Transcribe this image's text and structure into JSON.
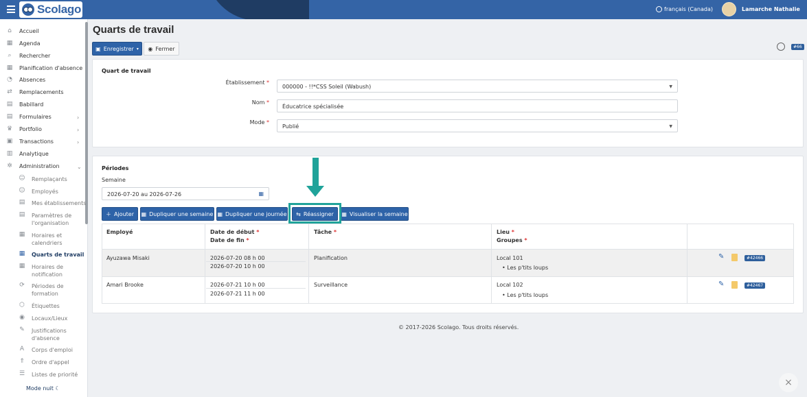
{
  "app": {
    "name": "Scolago"
  },
  "topbar": {
    "language": "français (Canada)",
    "user_name": "Lamarche Nathalie"
  },
  "sidebar": {
    "items": [
      {
        "label": "Accueil",
        "icon": "home-icon"
      },
      {
        "label": "Agenda",
        "icon": "calendar-icon"
      },
      {
        "label": "Rechercher",
        "icon": "search-icon"
      },
      {
        "label": "Planification d'absence",
        "icon": "calendar-icon"
      },
      {
        "label": "Absences",
        "icon": "user-absence-icon"
      },
      {
        "label": "Remplacements",
        "icon": "replacement-icon"
      },
      {
        "label": "Babillard",
        "icon": "board-icon"
      },
      {
        "label": "Formulaires",
        "icon": "form-icon"
      },
      {
        "label": "Portfolio",
        "icon": "trophy-icon"
      },
      {
        "label": "Transactions",
        "icon": "transactions-icon"
      },
      {
        "label": "Analytique",
        "icon": "analytics-icon"
      },
      {
        "label": "Administration",
        "icon": "gear-icon"
      }
    ],
    "admin_items": [
      {
        "label": "Remplaçants"
      },
      {
        "label": "Employés"
      },
      {
        "label": "Mes établissements"
      },
      {
        "label": "Paramètres de",
        "label2": "l'organisation"
      },
      {
        "label": "Horaires et",
        "label2": "calendriers"
      },
      {
        "label": "Quarts de travail"
      },
      {
        "label": "Horaires de",
        "label2": "notification"
      },
      {
        "label": "Périodes de",
        "label2": "formation"
      },
      {
        "label": "Étiquettes"
      },
      {
        "label": "Locaux/Lieux"
      },
      {
        "label": "Justifications",
        "label2": "d'absence"
      },
      {
        "label": "Corps d'emploi"
      },
      {
        "label": "Ordre d'appel"
      },
      {
        "label": "Listes de priorité"
      }
    ],
    "night_mode": "Mode nuit"
  },
  "page": {
    "title": "Quarts de travail",
    "save_label": "Enregistrer",
    "close_label": "Fermer",
    "id_badge": "#66"
  },
  "shift_card": {
    "title": "Quart de travail",
    "establishment_label": "Établissement",
    "establishment_value": "000000 - !!*CSS Soleil (Wabush)",
    "name_label": "Nom",
    "name_value": "Éducatrice spécialisée",
    "mode_label": "Mode",
    "mode_value": "Publié"
  },
  "periods": {
    "title": "Périodes",
    "week_label": "Semaine",
    "week_value": "2026-07-20 au 2026-07-26",
    "buttons": {
      "add": "Ajouter",
      "dup_week": "Dupliquer une semaine",
      "dup_day": "Dupliquer une journée",
      "reassign": "Réassigner",
      "view_week": "Visualiser la semaine"
    },
    "columns": {
      "employee": "Employé",
      "start": "Date de début",
      "end": "Date de fin",
      "task": "Tâche",
      "place": "Lieu",
      "groups": "Groupes"
    },
    "rows": [
      {
        "employee": "Ayuzawa Misaki",
        "start": "2026-07-20 08 h 00",
        "end": "2026-07-20 10 h 00",
        "task": "Planification",
        "place": "Local 101",
        "group": "Les p'tits loups",
        "id": "#42466"
      },
      {
        "employee": "Amari Brooke",
        "start": "2026-07-21 10 h 00",
        "end": "2026-07-21 11 h 00",
        "task": "Surveillance",
        "place": "Local 102",
        "group": "Les p'tits loups",
        "id": "#42467"
      }
    ]
  },
  "footer": {
    "copyright": "© 2017-2026 Scolago. Tous droits réservés."
  },
  "colors": {
    "primary": "#2e63a8",
    "header": "#3464a6",
    "highlight": "#20a39a"
  }
}
